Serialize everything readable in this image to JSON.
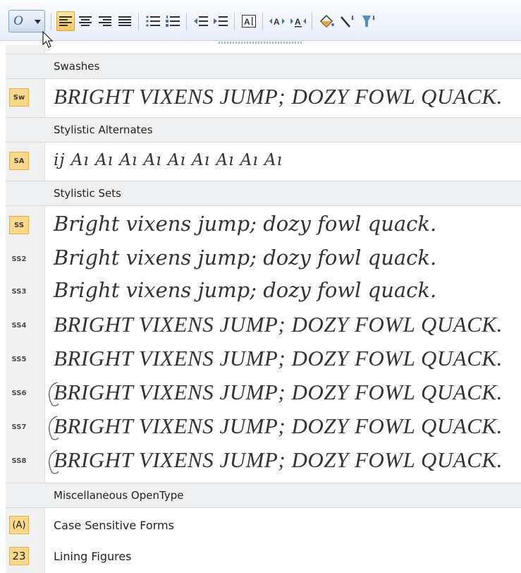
{
  "toolbar": {
    "opentype_button": {
      "label": "O",
      "icon": "opentype-icon"
    },
    "buttons": [
      {
        "name": "align-left-icon",
        "active": true
      },
      {
        "name": "align-center-icon"
      },
      {
        "name": "align-right-icon"
      },
      {
        "name": "justify-icon"
      },
      {
        "name": "bullets-icon"
      },
      {
        "name": "numbering-icon"
      },
      {
        "name": "decrease-indent-icon"
      },
      {
        "name": "increase-indent-icon"
      },
      {
        "name": "text-box-icon"
      },
      {
        "name": "increase-spacing-icon"
      },
      {
        "name": "decrease-spacing-icon"
      },
      {
        "name": "fill-color-icon"
      },
      {
        "name": "line-color-icon"
      },
      {
        "name": "effects-icon"
      }
    ]
  },
  "menu": {
    "swashes": {
      "header": "Swashes",
      "items": [
        {
          "badge": "Sw",
          "sample": "BRIGHT VIXENS JUMP; DOZY FOWL QUACK."
        }
      ]
    },
    "stylistic_alternates": {
      "header": "Stylistic Alternates",
      "items": [
        {
          "badge": "SA",
          "sample": "ij Aı Aı Aı Aı Aı Aı Aı Aı Aı"
        }
      ]
    },
    "stylistic_sets": {
      "header": "Stylistic Sets",
      "items": [
        {
          "badge": "SS",
          "sample": "Bright vixens jump; dozy fowl quack."
        },
        {
          "badge": "SS2",
          "sample": "Bright vixens jump; dozy fowl quack."
        },
        {
          "badge": "SS3",
          "sample": "Bright vixens jump; dozy fowl quack."
        },
        {
          "badge": "SS4",
          "sample": "BRIGHT VIXENS JUMP; DOZY FOWL QUACK."
        },
        {
          "badge": "SS5",
          "sample": "BRIGHT VIXENS JUMP; DOZY FOWL QUACK."
        },
        {
          "badge": "SS6",
          "sample": "BRIGHT VIXENS JUMP; DOZY FOWL QUACK."
        },
        {
          "badge": "SS7",
          "sample": "BRIGHT VIXENS JUMP; DOZY FOWL QUACK."
        },
        {
          "badge": "SS8",
          "sample": "BRIGHT VIXENS JUMP; DOZY FOWL QUACK."
        }
      ]
    },
    "misc": {
      "header": "Miscellaneous  OpenType",
      "items": [
        {
          "badge": "(A)",
          "label": "Case Sensitive Forms"
        },
        {
          "badge": "23",
          "label": "Lining Figures"
        }
      ]
    }
  },
  "colors": {
    "badge_fill": "#fcd98a",
    "header_fill": "#eef0f2",
    "toolbar_accent": "#3a5f94"
  }
}
